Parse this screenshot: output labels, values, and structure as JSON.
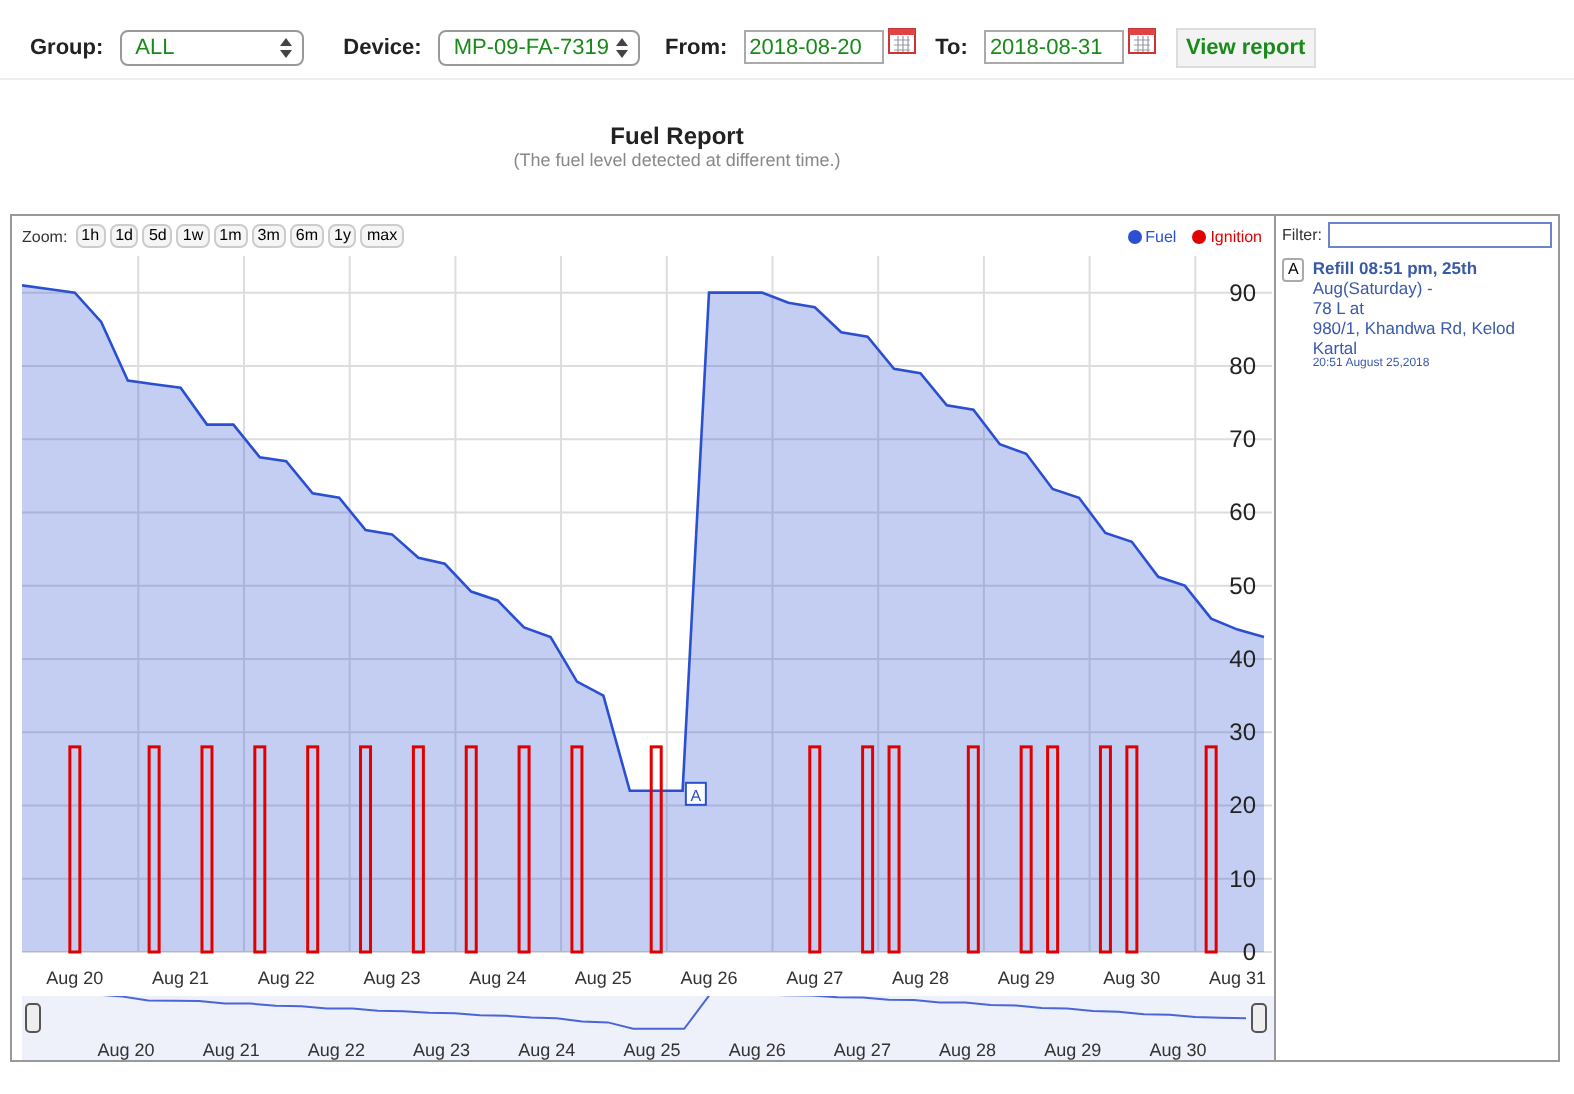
{
  "toolbar": {
    "group": {
      "label": "Group:",
      "value": "ALL"
    },
    "device": {
      "label": "Device:",
      "value": "MP-09-FA-7319"
    },
    "from": {
      "label": "From:",
      "value": "2018-08-20"
    },
    "to": {
      "label": "To:",
      "value": "2018-08-31"
    },
    "button": "View report"
  },
  "report": {
    "title": "Fuel Report",
    "subtitle": "(The fuel level detected at different time.)"
  },
  "zoom": {
    "label": "Zoom:",
    "buttons": [
      "1h",
      "1d",
      "5d",
      "1w",
      "1m",
      "3m",
      "6m",
      "1y",
      "max"
    ]
  },
  "chart_data": {
    "type": "area",
    "grid": true,
    "categories": [
      null,
      null,
      "Aug 20",
      null,
      null,
      null,
      "Aug 21",
      null,
      null,
      null,
      "Aug 22",
      null,
      null,
      null,
      "Aug 23",
      null,
      null,
      null,
      "Aug 24",
      null,
      null,
      null,
      "Aug 25",
      null,
      null,
      null,
      "Aug 26",
      null,
      null,
      null,
      "Aug 27",
      null,
      null,
      null,
      "Aug 28",
      null,
      null,
      null,
      "Aug 29",
      null,
      null,
      null,
      "Aug 30",
      null,
      null,
      null,
      "Aug 31",
      null
    ],
    "series": [
      {
        "name": "Fuel",
        "color": "#2b4fd1",
        "values": [
          91,
          90.5,
          90,
          86,
          78,
          77.5,
          77,
          72,
          72,
          67.5,
          67,
          62.6,
          62,
          57.6,
          57,
          53.8,
          53,
          49.2,
          48,
          44.3,
          43,
          36.9,
          35,
          22,
          22,
          22,
          90,
          90,
          90,
          88.6,
          88,
          84.6,
          84,
          79.6,
          79,
          74.6,
          74,
          69.3,
          68,
          63.2,
          62,
          57.2,
          56,
          51.2,
          50,
          45.5,
          44,
          43
        ]
      },
      {
        "name": "Ignition",
        "type": "bar",
        "color": "#e00000",
        "values": [
          0,
          0,
          28,
          0,
          0,
          28,
          0,
          28,
          0,
          28,
          0,
          28,
          0,
          28,
          0,
          28,
          0,
          28,
          0,
          28,
          0,
          28,
          0,
          0,
          28,
          0,
          0,
          0,
          0,
          0,
          28,
          0,
          28,
          28,
          0,
          0,
          28,
          0,
          28,
          28,
          0,
          28,
          28,
          0,
          0,
          28,
          0,
          0
        ]
      }
    ],
    "ylim": [
      0,
      95
    ],
    "yticks": [
      0,
      10,
      20,
      30,
      40,
      50,
      60,
      70,
      80,
      90
    ]
  },
  "refill_marker": {
    "text": "A"
  },
  "navigator": {
    "labels": [
      "Aug 20",
      "Aug 21",
      "Aug 22",
      "Aug 23",
      "Aug 24",
      "Aug 25",
      "Aug 26",
      "Aug 27",
      "Aug 28",
      "Aug 29",
      "Aug 30"
    ]
  },
  "filter": {
    "label": "Filter:"
  },
  "events": [
    {
      "marker": "A",
      "lines": [
        "Refill 08:51 pm, 25th",
        "Aug(Saturday) -",
        "78 L at",
        "980/1, Khandwa Rd, Kelod",
        "Kartal"
      ],
      "time": "20:51 August 25,2018"
    }
  ]
}
